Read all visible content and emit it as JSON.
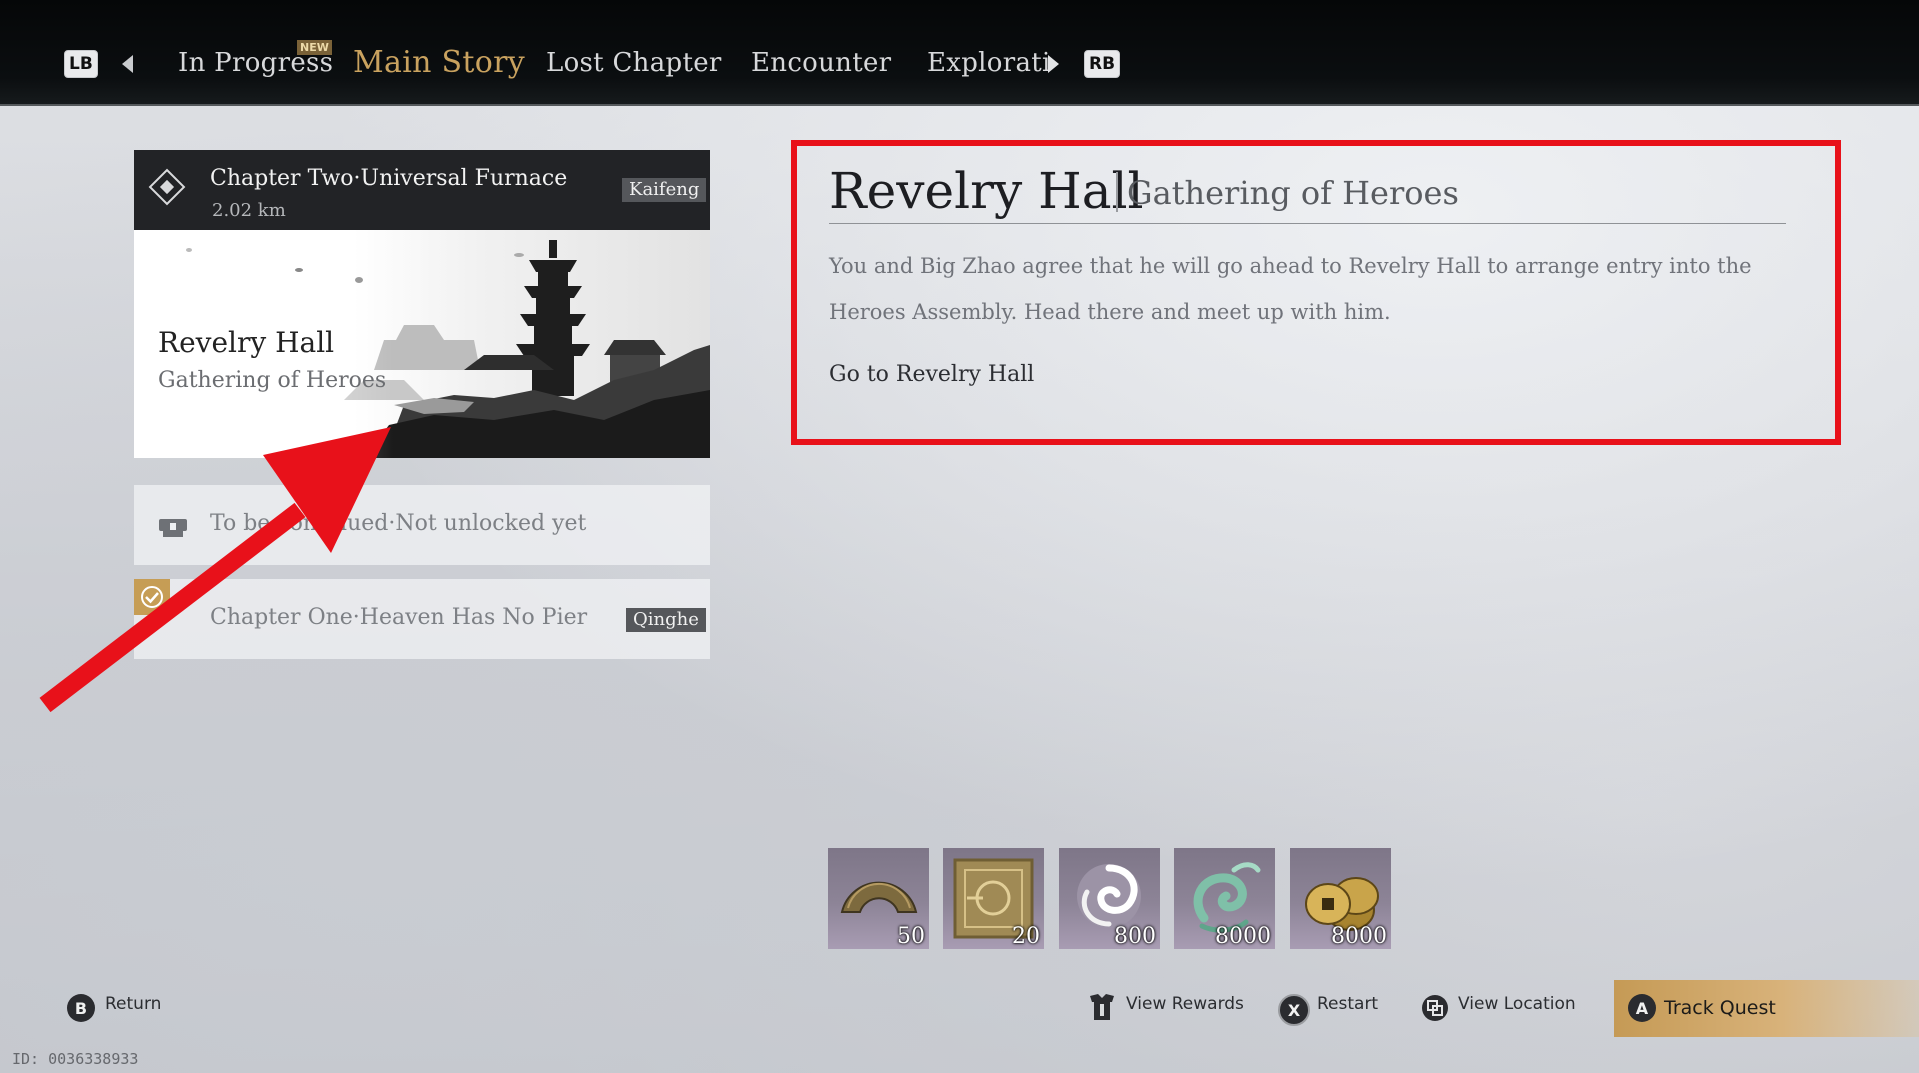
{
  "nav": {
    "left_shoulder": "LB",
    "right_shoulder": "RB",
    "new_badge": "NEW",
    "tabs": [
      {
        "label": "In Progress"
      },
      {
        "label": "Main Story",
        "active": true
      },
      {
        "label": "Lost Chapter"
      },
      {
        "label": "Encounter"
      },
      {
        "label": "Explorati"
      }
    ]
  },
  "quest_list": {
    "current": {
      "chapter": "Chapter Two·Universal Furnace",
      "distance": "2.02 km",
      "location": "Kaifeng",
      "quest_name": "Revelry Hall",
      "quest_subtitle": "Gathering of Heroes"
    },
    "locked": {
      "text": "To be continued·Not unlocked yet"
    },
    "completed": {
      "text": "Chapter One·Heaven Has No Pier",
      "location": "Qinghe"
    }
  },
  "detail": {
    "title": "Revelry Hall",
    "subtitle": "Gathering of Heroes",
    "description": "You and Big Zhao agree that he will go ahead to Revelry Hall to arrange entry into the Heroes Assembly. Head there and meet up with him.",
    "objective": "Go to Revelry Hall"
  },
  "rewards": [
    {
      "icon": "half-coin-icon",
      "qty": "50"
    },
    {
      "icon": "golden-token-icon",
      "qty": "20"
    },
    {
      "icon": "white-swirl-icon",
      "qty": "800"
    },
    {
      "icon": "jade-swirl-icon",
      "qty": "8000"
    },
    {
      "icon": "coin-stack-icon",
      "qty": "8000"
    }
  ],
  "footer": {
    "return": {
      "key": "B",
      "label": "Return"
    },
    "view_rewards": {
      "label": "View Rewards"
    },
    "restart": {
      "key": "X",
      "label": "Restart"
    },
    "view_location": {
      "label": "View Location"
    },
    "track_quest": {
      "key": "A",
      "label": "Track Quest"
    },
    "id_text": "ID: 0036338933"
  },
  "colors": {
    "accent_gold": "#c9a25f",
    "annotation_red": "#e8111a",
    "topbar": "#0b0e10"
  }
}
